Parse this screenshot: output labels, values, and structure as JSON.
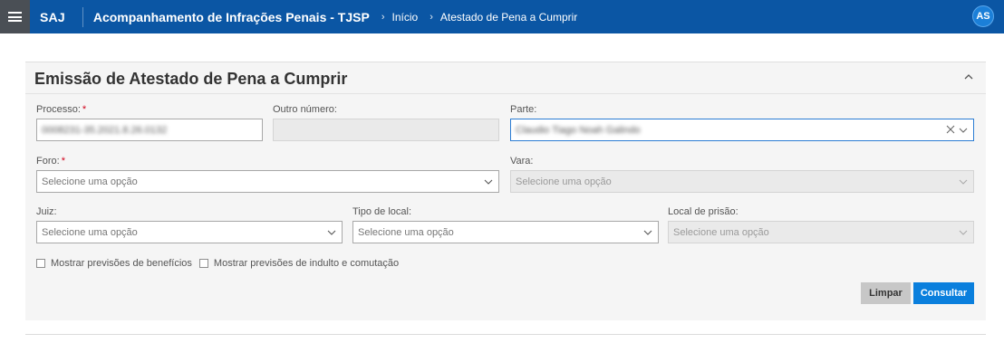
{
  "header": {
    "brand": "SAJ",
    "app_title": "Acompanhamento de Infrações Penais - TJSP",
    "breadcrumbs": [
      "Início",
      "Atestado de Pena a Cumprir"
    ],
    "avatar_initials": "AS",
    "colors": {
      "bar": "#0b56a4",
      "menu_bg": "#4a4f55",
      "avatar": "#1b7fd8"
    }
  },
  "panel": {
    "title": "Emissão de Atestado de Pena a Cumprir",
    "fields": {
      "processo": {
        "label": "Processo:",
        "required_mark": "*",
        "value": "0008231-35.2021.8.26.0132"
      },
      "outro_numero": {
        "label": "Outro número:",
        "value": ""
      },
      "parte": {
        "label": "Parte:",
        "value": "Claudio Tiago Noah Galindo"
      },
      "foro": {
        "label": "Foro:",
        "required_mark": "*",
        "placeholder": "Selecione uma opção"
      },
      "vara": {
        "label": "Vara:",
        "placeholder": "Selecione uma opção"
      },
      "juiz": {
        "label": "Juiz:",
        "placeholder": "Selecione uma opção"
      },
      "tipo_local": {
        "label": "Tipo de local:",
        "placeholder": "Selecione uma opção"
      },
      "local_prisao": {
        "label": "Local de prisão:",
        "placeholder": "Selecione uma opção"
      }
    },
    "checkboxes": [
      {
        "label": "Mostrar previsões de benefícios",
        "checked": false
      },
      {
        "label": "Mostrar previsões de indulto e comutação",
        "checked": false
      }
    ],
    "buttons": {
      "clear": "Limpar",
      "submit": "Consultar"
    },
    "colors": {
      "submit": "#0a7fdd",
      "clear": "#c7c7c7",
      "required": "#d0021b",
      "focus": "#2b7cd3"
    }
  }
}
